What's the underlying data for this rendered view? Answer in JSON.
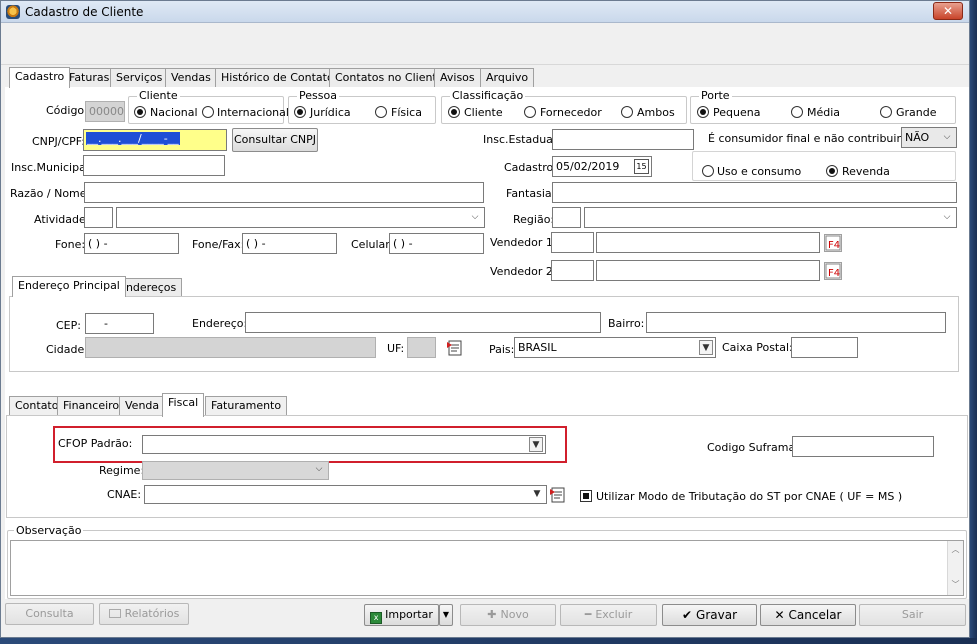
{
  "window": {
    "title": "Cadastro de Cliente",
    "close_label": "✕"
  },
  "main_tabs": [
    "Cadastro",
    "Faturas",
    "Serviços",
    "Vendas",
    "Histórico de Contatos",
    "Contatos no Cliente",
    "Avisos",
    "Arquivo"
  ],
  "form": {
    "codigo_label": "Código:",
    "codigo_value": "00000",
    "cliente": {
      "title": "Cliente",
      "options": [
        "Nacional",
        "Internacional"
      ],
      "selected": "Nacional"
    },
    "pessoa": {
      "title": "Pessoa",
      "options": [
        "Jurídica",
        "Física"
      ],
      "selected": "Jurídica"
    },
    "classificacao": {
      "title": "Classificação",
      "options": [
        "Cliente",
        "Fornecedor",
        "Ambos"
      ],
      "selected": "Cliente"
    },
    "porte": {
      "title": "Porte",
      "options": [
        "Pequena",
        "Média",
        "Grande"
      ],
      "selected": "Pequena"
    },
    "cnpj_label": "CNPJ/CPF:",
    "cnpj_value": "__.___.___/____-__",
    "consultar_cnpj": "Consultar CNPJ",
    "insc_estadual_label": "Insc.Estadual:",
    "consumidor_final_label": "É consumidor final e não contribuinte ?:",
    "consumidor_final_value": "NÃO",
    "insc_municipal_label": "Insc.Municipal:",
    "cadastro_label": "Cadastro:",
    "cadastro_value": "05/02/2019",
    "uso_revenda": {
      "options": [
        "Uso e consumo",
        "Revenda"
      ],
      "selected": "Revenda"
    },
    "razao_label": "Razão / Nome:",
    "fantasia_label": "Fantasia:",
    "atividade_label": "Atividade:",
    "regiao_label": "Região:",
    "fone_label": "Fone:",
    "fone_value": "(  )    -",
    "fonefax_label": "Fone/Fax:",
    "fonefax_value": "(  )    -",
    "celular_label": "Celular:",
    "celular_value": "(  )    -",
    "vendedor1_label": "Vendedor 1:",
    "vendedor2_label": "Vendedor 2:"
  },
  "address_tabs": [
    "Endereço Principal",
    "Endereços"
  ],
  "address": {
    "cep_label": "CEP:",
    "cep_value": "-",
    "endereco_label": "Endereço:",
    "bairro_label": "Bairro:",
    "cidade_label": "Cidade:",
    "uf_label": "UF:",
    "pais_label": "Pais:",
    "pais_value": "BRASIL",
    "caixa_postal_label": "Caixa Postal:"
  },
  "sub_tabs": [
    "Contato",
    "Financeiro",
    "Venda",
    "Fiscal",
    "Faturamento"
  ],
  "fiscal": {
    "cfop_label": "CFOP Padrão:",
    "suframa_label": "Codigo Suframa :",
    "regime_label": "Regime:",
    "cnae_label": "CNAE:",
    "st_label": "Utilizar Modo de Tributação do ST por CNAE ( UF = MS )"
  },
  "observacao_label": "Observação",
  "footer": {
    "consulta": "Consulta",
    "relatorios": "Relatórios",
    "importar": "Importar",
    "novo": "Novo",
    "excluir": "Excluir",
    "gravar": "Gravar",
    "cancelar": "Cancelar",
    "sair": "Sair"
  }
}
